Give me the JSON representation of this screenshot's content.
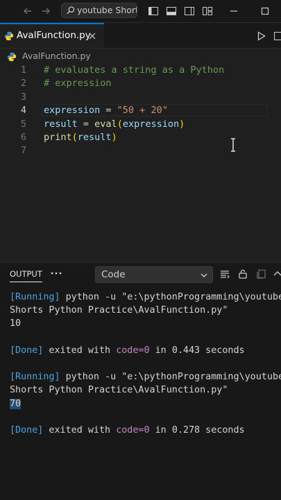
{
  "titlebar": {
    "search_text": "youtube Short..."
  },
  "tab": {
    "label": "AvalFunction.py",
    "close": "✕"
  },
  "breadcrumb": {
    "file": "AvalFunction.py"
  },
  "editor": {
    "lines": [
      {
        "num": "1",
        "tokens": [
          {
            "t": "# evaluates a string as a Python",
            "c": "c-comment"
          }
        ]
      },
      {
        "num": "2",
        "tokens": [
          {
            "t": "# expression",
            "c": "c-comment"
          }
        ]
      },
      {
        "num": "3",
        "tokens": []
      },
      {
        "num": "4",
        "active": true,
        "tokens": [
          {
            "t": "expression",
            "c": "c-var"
          },
          {
            "t": " = ",
            "c": "c-op"
          },
          {
            "t": "\"50 + 20\"",
            "c": "c-str"
          }
        ]
      },
      {
        "num": "5",
        "tokens": [
          {
            "t": "result",
            "c": "c-var"
          },
          {
            "t": " = ",
            "c": "c-op"
          },
          {
            "t": "eval",
            "c": "c-fn"
          },
          {
            "t": "(",
            "c": "c-paren"
          },
          {
            "t": "expression",
            "c": "c-var"
          },
          {
            "t": ")",
            "c": "c-paren"
          }
        ]
      },
      {
        "num": "6",
        "tokens": [
          {
            "t": "print",
            "c": "c-fn"
          },
          {
            "t": "(",
            "c": "c-paren"
          },
          {
            "t": "result",
            "c": "c-var"
          },
          {
            "t": ")",
            "c": "c-paren"
          }
        ]
      },
      {
        "num": "7",
        "tokens": []
      }
    ]
  },
  "panel": {
    "tab_label": "OUTPUT",
    "channel": "Code",
    "output_lines": [
      [
        {
          "t": "[Running]",
          "c": "o-running"
        },
        {
          "t": " python -u \"e:\\pythonProgramming\\youtube",
          "c": "o-white"
        }
      ],
      [
        {
          "t": "Shorts Python Practice\\AvalFunction.py\"",
          "c": "o-white"
        }
      ],
      [
        {
          "t": "10",
          "c": "o-white"
        }
      ],
      [],
      [
        {
          "t": "[Done]",
          "c": "o-done"
        },
        {
          "t": " exited with ",
          "c": "o-white"
        },
        {
          "t": "code=0",
          "c": "o-code"
        },
        {
          "t": " in ",
          "c": "o-white"
        },
        {
          "t": "0.443",
          "c": "o-white"
        },
        {
          "t": " seconds",
          "c": "o-white"
        }
      ],
      [],
      [
        {
          "t": "[Running]",
          "c": "o-running"
        },
        {
          "t": " python -u \"e:\\pythonProgramming\\youtube",
          "c": "o-white"
        }
      ],
      [
        {
          "t": "Shorts Python Practice\\AvalFunction.py\"",
          "c": "o-white"
        }
      ],
      [
        {
          "t": "70",
          "c": "o-white o-sel"
        }
      ],
      [],
      [
        {
          "t": "[Done]",
          "c": "o-done"
        },
        {
          "t": " exited with ",
          "c": "o-white"
        },
        {
          "t": "code=0",
          "c": "o-code"
        },
        {
          "t": " in ",
          "c": "o-white"
        },
        {
          "t": "0.278",
          "c": "o-white"
        },
        {
          "t": " seconds",
          "c": "o-white"
        }
      ]
    ]
  }
}
